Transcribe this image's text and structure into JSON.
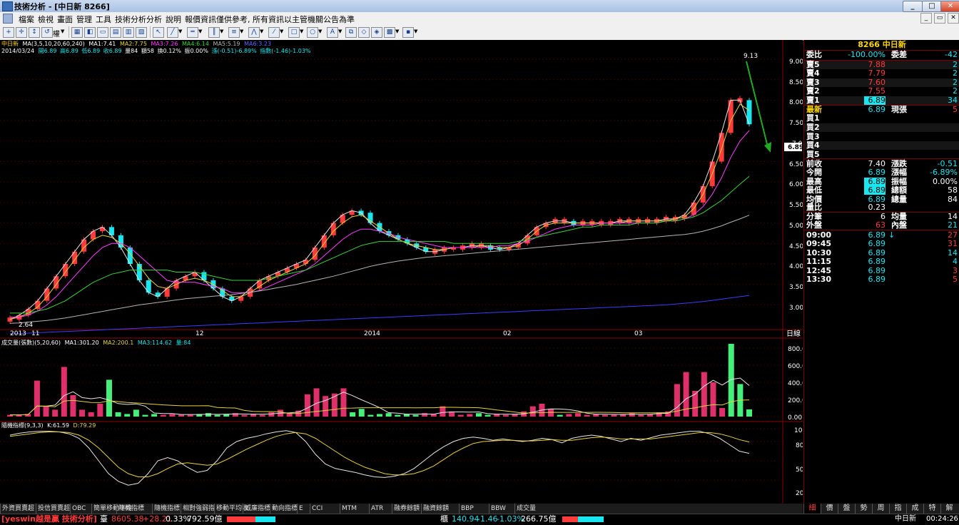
{
  "window": {
    "title": "技術分析 - [中日新 8266]"
  },
  "menu": [
    "檔案",
    "檢視",
    "畫面",
    "管理",
    "工具",
    "技術分析",
    "分析",
    "說明"
  ],
  "menu_notice": "報價資訊僅供參考, 所有資訊以主管機關公告為準",
  "toolbar": {
    "dropdown_label": "權"
  },
  "chart_header": {
    "stock": "中日新",
    "ma_label": "MA(3,5,10,20,60,240)",
    "ma1": "MA1:7.41",
    "ma2": "MA2:7.75",
    "ma3": "MA3:7.26",
    "ma4": "MA4:6.14",
    "ma5": "MA5:5.19",
    "ma6": "MA6:3.23",
    "info_date": "2014/03/24",
    "info_open": "開6.89",
    "info_high": "高6.89",
    "info_low": "低6.89",
    "info_close": "收6.89",
    "info_vol": "量84",
    "info_amt": "額58",
    "info_turn": "換0.12%",
    "info_amp": "振0.00%",
    "info_chg": "漲(-0.51)-6.89%",
    "info_idx": "指數(-1.46)-1.03%"
  },
  "price_axis": [
    "9.00",
    "8.50",
    "8.00",
    "7.50",
    "7.00",
    "6.50",
    "6.00",
    "5.50",
    "5.00",
    "4.50",
    "4.00",
    "3.50",
    "3.00"
  ],
  "price_marker": "6.89",
  "date_axis": [
    "2013",
    "11",
    "12",
    "2014",
    "02",
    "03"
  ],
  "period_label": "日線",
  "annot_high": "9.13",
  "annot_low": "2.64",
  "vol_header": {
    "name": "成交量(張數)(5,20,60)",
    "ma1": "MA1:301.20",
    "ma2": "MA2:200.1",
    "ma3": "MA3:114.62",
    "vol": "量:84"
  },
  "vol_axis": [
    "800.00",
    "600.00",
    "400.00",
    "200.00",
    "0.00"
  ],
  "kd_header": {
    "name": "隨機指標(9,3,3)",
    "k": "K:61.59",
    "d": "D:79.29"
  },
  "kd_axis": [
    "100",
    "80",
    "50",
    "20"
  ],
  "quote": {
    "code_name": "8266 中日新",
    "ratio_label": "委比",
    "ratio": "-100.00%",
    "diff_label": "委差",
    "diff": "-42",
    "asks": [
      {
        "label": "賣5",
        "price": "7.88",
        "qty": "2"
      },
      {
        "label": "賣4",
        "price": "7.79",
        "qty": "2"
      },
      {
        "label": "賣3",
        "price": "7.60",
        "qty": "2"
      },
      {
        "label": "賣2",
        "price": "7.55",
        "qty": "2"
      },
      {
        "label": "賣1",
        "price": "6.89",
        "qty": "34"
      }
    ],
    "last_label": "最新",
    "last": "6.89",
    "last_unit": "現張",
    "last_qty": "5",
    "bids": [
      "買1",
      "買2",
      "買3",
      "買4",
      "買5"
    ],
    "stats": [
      {
        "l1": "前收",
        "v1": "7.40",
        "l2": "漲跌",
        "v2": "-0.51"
      },
      {
        "l1": "今開",
        "v1": "6.89",
        "l2": "漲幅",
        "v2": "-6.89%"
      },
      {
        "l1": "最高",
        "v1": "6.89",
        "l2": "振幅",
        "v2": "0.00%"
      },
      {
        "l1": "最低",
        "v1": "6.89",
        "l2": "總額",
        "v2": "58"
      },
      {
        "l1": "均價",
        "v1": "6.89",
        "l2": "總量",
        "v2": "84"
      }
    ],
    "volratio_label": "量比",
    "volratio": "0.23",
    "ticks_label": "分筆",
    "ticks": "6",
    "avgvol_label": "均量",
    "avgvol": "14",
    "outer_label": "外盤",
    "outer": "63",
    "inner_label": "內盤",
    "inner": "21",
    "trades": [
      {
        "t": "09:00",
        "p": "6.89",
        "q": "27"
      },
      {
        "t": "09:45",
        "p": "6.89",
        "q": "31"
      },
      {
        "t": "10:30",
        "p": "6.89",
        "q": "14"
      },
      {
        "t": "11:15",
        "p": "6.89",
        "q": "4"
      },
      {
        "t": "12:45",
        "p": "6.89",
        "q": "3"
      },
      {
        "t": "13:30",
        "p": "6.89",
        "q": "5"
      }
    ]
  },
  "right_tabs": [
    "細",
    "價",
    "盤",
    "勢",
    "周",
    "指",
    "成",
    "特",
    "解"
  ],
  "bottom_tabs": [
    "外資買賣超",
    "投信買賣超",
    "OBC",
    "簡單移動平均",
    "隨機指標",
    "隨機指標",
    "相對強弱指",
    "移動平均收",
    "威廉指標",
    "動向指標",
    "E",
    "CCI",
    "MTM",
    "ATR",
    "融券餘額",
    "融資餘額",
    "BBP",
    "BBW",
    "成交量"
  ],
  "status": {
    "brand": "[yeswin越是贏 技術分析]",
    "idx1_label": "臺",
    "idx1": "8605.38",
    "idx1_chg": "+28.21",
    "idx1_pct": "0.33%",
    "idx1_amt": "792.59億",
    "idx2_label": "櫃",
    "idx2": "140.94",
    "idx2_chg": "-1.46",
    "idx2_pct": "-1.03%",
    "idx2_amt": "266.75億",
    "tab": "中日新",
    "time": "00:24:26"
  },
  "colors": {
    "up": "#ff3b3b",
    "down": "#19e6ee",
    "ma_white": "#e6e6e6",
    "ma_yellow": "#e8d23a",
    "ma_magenta": "#ff3cff",
    "ma_green": "#3ad23a",
    "ma_gray": "#b4b4b4",
    "ma_blue": "#3c3cff",
    "vol_up": "#e0306b",
    "vol_down": "#44f07a"
  },
  "chart_data": [
    {
      "type": "candlestick",
      "title": "",
      "ylim": [
        2.5,
        9.3
      ],
      "x_ticks": [
        "2013",
        "11",
        "12",
        "2014",
        "02",
        "03"
      ],
      "series": [
        {
          "name": "MA1:7.41",
          "values": [
            2.64,
            2.75,
            2.9,
            3.1,
            3.4,
            3.7,
            4.0,
            4.3,
            4.6,
            4.8,
            4.9,
            4.7,
            4.4,
            4.0,
            3.6,
            3.3,
            3.2,
            3.4,
            3.6,
            3.7,
            3.8,
            3.6,
            3.4,
            3.2,
            3.1,
            3.2,
            3.4,
            3.6,
            3.7,
            3.8,
            3.9,
            4.0,
            4.1,
            4.4,
            4.7,
            5.0,
            5.2,
            5.3,
            5.25,
            5.0,
            4.8,
            4.7,
            4.6,
            4.5,
            4.4,
            4.3,
            4.3,
            4.35,
            4.4,
            4.4,
            4.45,
            4.45,
            4.4,
            4.35,
            4.4,
            4.5,
            4.7,
            4.9,
            5.0,
            5.05,
            5.05,
            5.0,
            5.0,
            5.0,
            5.0,
            5.0,
            5.05,
            5.05,
            5.05,
            5.05,
            5.05,
            5.1,
            5.1,
            5.2,
            5.5,
            5.9,
            6.5,
            7.2,
            8.0,
            8.0,
            7.41
          ]
        },
        {
          "name": "MA2:7.75",
          "values": [
            2.65,
            2.7,
            2.8,
            2.95,
            3.2,
            3.5,
            3.8,
            4.1,
            4.4,
            4.6,
            4.7,
            4.65,
            4.5,
            4.25,
            3.95,
            3.65,
            3.45,
            3.4,
            3.5,
            3.6,
            3.65,
            3.6,
            3.5,
            3.35,
            3.2,
            3.2,
            3.3,
            3.45,
            3.6,
            3.7,
            3.8,
            3.9,
            4.0,
            4.2,
            4.5,
            4.8,
            5.0,
            5.15,
            5.2,
            5.05,
            4.9,
            4.75,
            4.6,
            4.5,
            4.45,
            4.4,
            4.35,
            4.35,
            4.4,
            4.4,
            4.4,
            4.45,
            4.45,
            4.4,
            4.4,
            4.45,
            4.6,
            4.8,
            4.95,
            5.0,
            5.0,
            5.0,
            5.0,
            5.0,
            5.0,
            5.0,
            5.0,
            5.05,
            5.05,
            5.05,
            5.05,
            5.05,
            5.1,
            5.15,
            5.35,
            5.7,
            6.2,
            6.8,
            7.5,
            7.9,
            7.75
          ]
        },
        {
          "name": "MA3:7.26",
          "values": [
            2.7,
            2.7,
            2.75,
            2.85,
            3.0,
            3.2,
            3.45,
            3.7,
            3.95,
            4.2,
            4.4,
            4.5,
            4.5,
            4.4,
            4.2,
            4.0,
            3.8,
            3.6,
            3.55,
            3.55,
            3.55,
            3.5,
            3.45,
            3.4,
            3.3,
            3.3,
            3.3,
            3.35,
            3.45,
            3.55,
            3.65,
            3.75,
            3.85,
            4.0,
            4.2,
            4.4,
            4.6,
            4.75,
            4.85,
            4.85,
            4.8,
            4.75,
            4.65,
            4.6,
            4.55,
            4.5,
            4.45,
            4.4,
            4.4,
            4.4,
            4.4,
            4.4,
            4.4,
            4.45,
            4.45,
            4.5,
            4.55,
            4.65,
            4.75,
            4.85,
            4.9,
            4.95,
            4.95,
            4.95,
            5.0,
            5.0,
            5.0,
            5.0,
            5.0,
            5.0,
            5.0,
            5.05,
            5.05,
            5.1,
            5.2,
            5.4,
            5.7,
            6.1,
            6.6,
            7.0,
            7.26
          ]
        },
        {
          "name": "MA4:6.14",
          "values": [
            2.8,
            2.8,
            2.8,
            2.85,
            2.9,
            3.0,
            3.1,
            3.25,
            3.4,
            3.55,
            3.65,
            3.75,
            3.8,
            3.85,
            3.85,
            3.85,
            3.85,
            3.85,
            3.8,
            3.8,
            3.8,
            3.75,
            3.7,
            3.65,
            3.6,
            3.6,
            3.6,
            3.6,
            3.65,
            3.7,
            3.75,
            3.8,
            3.85,
            3.95,
            4.05,
            4.15,
            4.25,
            4.35,
            4.45,
            4.5,
            4.55,
            4.55,
            4.55,
            4.55,
            4.55,
            4.55,
            4.55,
            4.55,
            4.5,
            4.5,
            4.5,
            4.5,
            4.5,
            4.5,
            4.5,
            4.55,
            4.6,
            4.65,
            4.7,
            4.75,
            4.8,
            4.85,
            4.9,
            4.9,
            4.95,
            4.95,
            4.95,
            4.95,
            5.0,
            5.0,
            5.0,
            5.05,
            5.05,
            5.1,
            5.15,
            5.25,
            5.4,
            5.55,
            5.75,
            5.95,
            6.14
          ]
        },
        {
          "name": "MA5:5.19",
          "values": [
            2.55,
            2.56,
            2.58,
            2.6,
            2.62,
            2.65,
            2.68,
            2.72,
            2.76,
            2.8,
            2.84,
            2.88,
            2.92,
            2.96,
            3.0,
            3.03,
            3.06,
            3.09,
            3.12,
            3.15,
            3.17,
            3.19,
            3.21,
            3.23,
            3.25,
            3.28,
            3.31,
            3.34,
            3.38,
            3.42,
            3.46,
            3.5,
            3.55,
            3.6,
            3.65,
            3.7,
            3.76,
            3.82,
            3.88,
            3.94,
            3.99,
            4.03,
            4.07,
            4.1,
            4.13,
            4.16,
            4.18,
            4.2,
            4.22,
            4.24,
            4.26,
            4.28,
            4.3,
            4.32,
            4.34,
            4.36,
            4.38,
            4.4,
            4.42,
            4.44,
            4.46,
            4.48,
            4.5,
            4.52,
            4.54,
            4.56,
            4.58,
            4.6,
            4.62,
            4.64,
            4.66,
            4.68,
            4.7,
            4.72,
            4.75,
            4.8,
            4.86,
            4.93,
            5.02,
            5.1,
            5.19
          ]
        },
        {
          "name": "MA6:3.23",
          "values": [
            2.3,
            2.3,
            2.31,
            2.32,
            2.33,
            2.34,
            2.35,
            2.36,
            2.37,
            2.38,
            2.39,
            2.4,
            2.41,
            2.42,
            2.43,
            2.44,
            2.45,
            2.46,
            2.47,
            2.48,
            2.49,
            2.5,
            2.51,
            2.52,
            2.53,
            2.54,
            2.55,
            2.56,
            2.57,
            2.58,
            2.59,
            2.6,
            2.61,
            2.62,
            2.63,
            2.64,
            2.65,
            2.66,
            2.67,
            2.68,
            2.69,
            2.7,
            2.71,
            2.72,
            2.73,
            2.74,
            2.75,
            2.76,
            2.77,
            2.78,
            2.79,
            2.8,
            2.81,
            2.82,
            2.83,
            2.84,
            2.85,
            2.86,
            2.87,
            2.88,
            2.89,
            2.9,
            2.91,
            2.92,
            2.93,
            2.94,
            2.95,
            2.96,
            2.97,
            2.98,
            2.99,
            3.0,
            3.02,
            3.04,
            3.06,
            3.08,
            3.11,
            3.14,
            3.17,
            3.2,
            3.23
          ]
        }
      ]
    },
    {
      "type": "bar",
      "title": "",
      "ylim": [
        0,
        850
      ],
      "values": [
        20,
        20,
        30,
        420,
        120,
        80,
        580,
        250,
        80,
        50,
        150,
        430,
        50,
        30,
        80,
        20,
        30,
        20,
        30,
        20,
        20,
        30,
        40,
        20,
        30,
        40,
        20,
        30,
        20,
        50,
        80,
        40,
        70,
        260,
        330,
        240,
        270,
        330,
        50,
        90,
        20,
        30,
        40,
        20,
        30,
        20,
        40,
        30,
        120,
        60,
        20,
        30,
        40,
        20,
        30,
        20,
        30,
        60,
        120,
        150,
        90,
        20,
        30,
        40,
        20,
        30,
        20,
        20,
        30,
        40,
        20,
        30,
        50,
        60,
        380,
        520,
        300,
        520,
        400,
        100,
        850,
        380,
        84
      ]
    },
    {
      "type": "line",
      "title": "",
      "ylim": [
        0,
        100
      ],
      "series": [
        {
          "name": "K:61.59",
          "values": [
            90,
            93,
            95,
            96,
            96,
            95,
            92,
            85,
            70,
            50,
            30,
            18,
            12,
            15,
            30,
            50,
            55,
            50,
            40,
            32,
            35,
            50,
            70,
            80,
            85,
            88,
            92,
            95,
            97,
            94,
            80,
            60,
            45,
            38,
            35,
            32,
            28,
            25,
            24,
            26,
            30,
            38,
            50,
            62,
            72,
            80,
            85,
            87,
            85,
            82,
            84,
            82,
            80,
            82,
            85,
            83,
            78,
            85,
            88,
            90,
            88,
            84,
            80,
            85,
            82,
            86,
            90,
            92,
            94,
            96,
            96,
            92,
            85,
            75,
            65,
            61.59
          ]
        },
        {
          "name": "D:79.29",
          "values": [
            88,
            90,
            92,
            94,
            95,
            95,
            94,
            90,
            82,
            70,
            55,
            40,
            30,
            25,
            25,
            30,
            38,
            45,
            47,
            45,
            43,
            45,
            52,
            60,
            68,
            75,
            82,
            88,
            92,
            94,
            92,
            85,
            75,
            65,
            55,
            47,
            40,
            35,
            30,
            28,
            28,
            30,
            35,
            42,
            52,
            62,
            70,
            77,
            80,
            81,
            82,
            82,
            81,
            81,
            82,
            83,
            82,
            82,
            84,
            86,
            87,
            86,
            84,
            84,
            84,
            84,
            86,
            88,
            90,
            92,
            94,
            94,
            92,
            88,
            83,
            79.29
          ]
        }
      ]
    }
  ]
}
